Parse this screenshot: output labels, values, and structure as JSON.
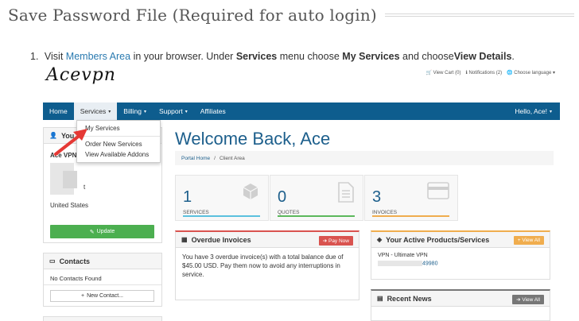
{
  "doc": {
    "title": "Save Password File (Required for auto login)",
    "step_number": "1.",
    "step_visit": "Visit",
    "step_link": "Members Area",
    "step_in_browser": "in your browser. Under",
    "step_services": "Services",
    "step_menu_choose": "menu choose",
    "step_my_services": "My Services",
    "step_and_choose": "and choose",
    "step_view_details": "View Details",
    "step_end": "."
  },
  "portal": {
    "logo": "Acevpn",
    "toplinks": [
      "View Cart (0)",
      "Notifications (2)",
      "Choose language"
    ],
    "nav": [
      "Home",
      "Services",
      "Billing",
      "Support",
      "Affiliates"
    ],
    "nav_caret": "▾",
    "greeting": "Hello, Ace!",
    "dropdown": {
      "items": [
        "My Services",
        "Order New Services",
        "View Available Addons"
      ]
    },
    "your_info": {
      "title": "You",
      "company": "Ace VPN",
      "partial": "t",
      "country": "United States",
      "update_label": "Update"
    },
    "contacts": {
      "title": "Contacts",
      "none": "No Contacts Found",
      "new_label": "New Contact..."
    },
    "welcome": "Welcome Back, Ace",
    "breadcrumb": [
      "Portal Home",
      "/",
      "Client Area"
    ],
    "stats": [
      {
        "value": "1",
        "label": "SERVICES",
        "color": "#5bc0de"
      },
      {
        "value": "0",
        "label": "QUOTES",
        "color": "#5cb85c"
      },
      {
        "value": "3",
        "label": "INVOICES",
        "color": "#f0ad4e"
      }
    ],
    "overdue": {
      "title": "Overdue Invoices",
      "badge": "Pay Now",
      "text": "You have 3 overdue invoice(s) with a total balance due of $45.00 USD. Pay them now to avoid any interruptions in service."
    },
    "products": {
      "title": "Your Active Products/Services",
      "badge": "View All",
      "product": "VPN - Ultimate VPN",
      "id_suffix": "49980"
    },
    "news": {
      "title": "Recent News",
      "badge": "View All"
    }
  }
}
